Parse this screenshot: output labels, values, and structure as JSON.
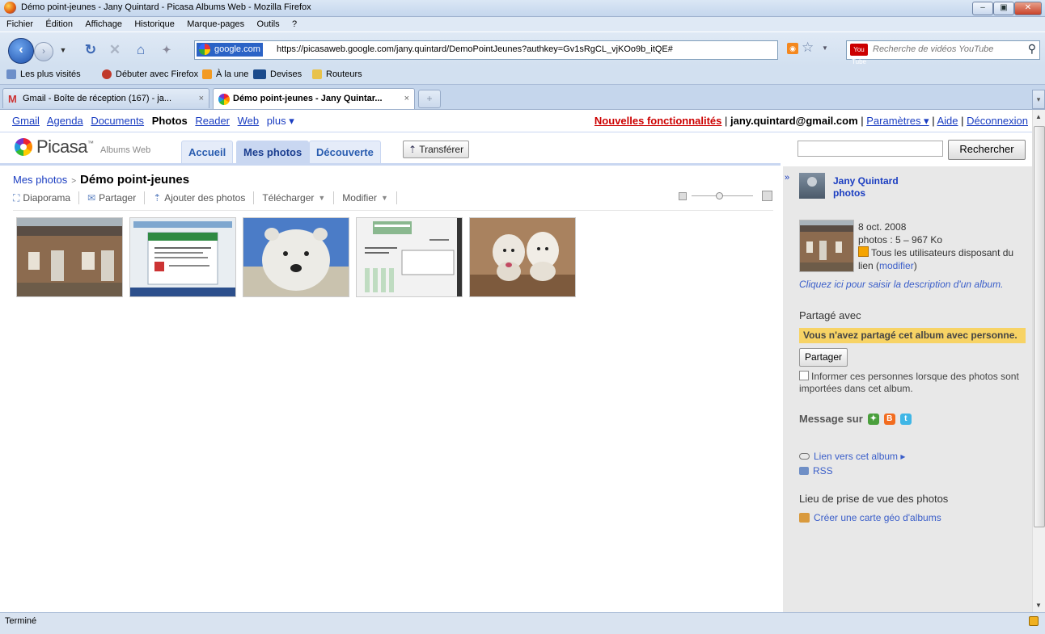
{
  "window": {
    "title": "Démo point-jeunes - Jany Quintard - Picasa Albums Web - Mozilla Firefox"
  },
  "menu": [
    "Fichier",
    "Édition",
    "Affichage",
    "Historique",
    "Marque-pages",
    "Outils",
    "?"
  ],
  "nav": {
    "site_badge": "google.com",
    "url": "https://picasaweb.google.com/jany.quintard/DemoPointJeunes?authkey=Gv1sRgCL_vjKOo9b_itQE#",
    "search_placeholder": "Recherche de vidéos YouTube",
    "yt_badge": "You Tube"
  },
  "bookmarks": [
    "Les plus visités",
    "Débuter avec Firefox",
    "À la une",
    "Devises",
    "Routeurs"
  ],
  "tabs": [
    {
      "label": "Gmail - Boîte de réception (167) - ja...",
      "active": false
    },
    {
      "label": "Démo point-jeunes - Jany Quintar...",
      "active": true
    }
  ],
  "gbar": {
    "links": [
      "Gmail",
      "Agenda",
      "Documents",
      "Photos",
      "Reader",
      "Web",
      "plus ▾"
    ],
    "new_features": "Nouvelles fonctionnalités",
    "email": "jany.quintard@gmail.com",
    "settings": "Paramètres ▾",
    "help": "Aide",
    "logout": "Déconnexion"
  },
  "picasa": {
    "logo": "Picasa",
    "logo_sub": "Albums Web",
    "tabs": [
      "Accueil",
      "Mes photos",
      "Découverte"
    ],
    "upload": "Transférer",
    "search_button": "Rechercher"
  },
  "breadcrumb": {
    "parent": "Mes photos",
    "current": "Démo point-jeunes"
  },
  "actions": [
    "Diaporama",
    "Partager",
    "Ajouter des photos",
    "Télécharger",
    "Modifier"
  ],
  "zoom_level": 0.45,
  "photos": [
    {
      "name": "maison-brique",
      "colors": [
        "#8c6b4f",
        "#a9b3ba",
        "#6d5c49"
      ]
    },
    {
      "name": "capture-ecran",
      "colors": [
        "#e9eef2",
        "#2f8a42",
        "#c33"
      ]
    },
    {
      "name": "ours-polaire",
      "colors": [
        "#ecebe6",
        "#4b7cc7",
        "#c9c2ae"
      ]
    },
    {
      "name": "document-scan",
      "colors": [
        "#f2f2f2",
        "#8ab88f",
        "#666"
      ]
    },
    {
      "name": "chiens",
      "colors": [
        "#a9825f",
        "#ece7df",
        "#7d5a3d"
      ]
    }
  ],
  "sidebar": {
    "user_name": "Jany Quintard",
    "user_sub": "photos",
    "album_date": "8 oct. 2008",
    "album_stats": "photos : 5 – 967 Ko",
    "visibility": "Tous les utilisateurs disposant du lien (",
    "visibility_link": "modifier",
    "visibility_end": ")",
    "description_prompt": "Cliquez ici pour saisir la description d'un album.",
    "shared_with_title": "Partagé avec",
    "shared_notice": "Vous n'avez partagé cet album avec personne.",
    "share_button": "Partager",
    "notify_text": "Informer ces personnes lorsque des photos sont importées dans cet album.",
    "message_on": "Message sur",
    "album_link": "Lien vers cet album ▸",
    "rss": "RSS",
    "location_title": "Lieu de prise de vue des photos",
    "map_link": "Créer une carte géo d'albums"
  },
  "status": "Terminé"
}
